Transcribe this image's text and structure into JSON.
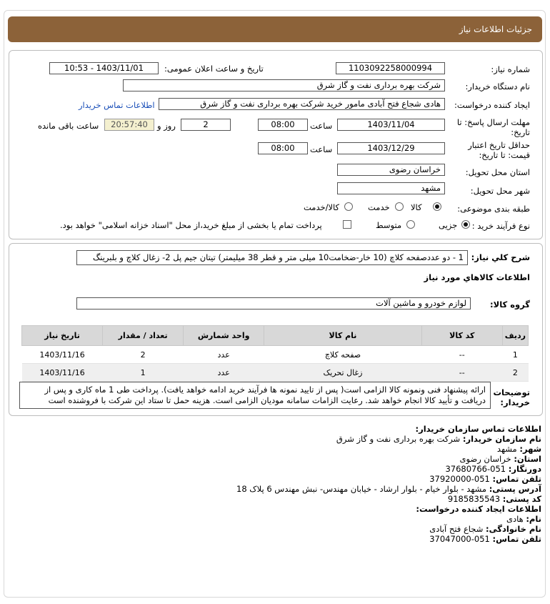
{
  "header": {
    "title": "جزئیات اطلاعات نیاز"
  },
  "form": {
    "need_number_label": "شماره نیاز:",
    "need_number": "1103092258000994",
    "announce_label": "تاریخ و ساعت اعلان عمومی:",
    "announce_value": "1403/11/01 - 10:53",
    "buyer_label": "نام دستگاه خریدار:",
    "buyer_value": "شرکت بهره برداری نفت و گاز شرق",
    "creator_label": "ایجاد کننده درخواست:",
    "creator_value": "هادی شجاع فتح آبادی مامور خرید شرکت بهره برداری نفت و گاز شرق",
    "contact_link": "اطلاعات تماس خریدار",
    "deadline_label_1": "مهلت ارسال پاسخ: تا",
    "deadline_label_2": "تاریخ:",
    "deadline_date": "1403/11/04",
    "time_label": "ساعت",
    "deadline_time": "08:00",
    "days_value": "2",
    "days_label": "روز و",
    "remaining_time": "20:57:40",
    "remaining_label": "ساعت باقی مانده",
    "validity_label_1": "حداقل تاریخ اعتبار",
    "validity_label_2": "قیمت: تا تاریخ:",
    "validity_date": "1403/12/29",
    "validity_time": "08:00",
    "province_label": "استان محل تحویل:",
    "province_value": "خراسان رضوی",
    "city_label": "شهر محل تحویل:",
    "city_value": "مشهد",
    "category_label": "طبقه بندی موضوعی:",
    "category_options": [
      "کالا",
      "خدمت",
      "کالا/خدمت"
    ],
    "category_selected": "کالا",
    "process_label": "نوع فرآیند خرید :",
    "process_options": [
      "جزیی",
      "متوسط"
    ],
    "process_selected": "جزیی",
    "treasury_text": "پرداخت تمام یا بخشی از مبلغ خرید،از محل \"اسناد خزانه اسلامی\" خواهد بود."
  },
  "description": {
    "label": "شرح کلي نياز:",
    "value": "1 - دو عددصفحه کلاچ (10 خار-ضخامت10 میلی متر و قطر 38 میلیمتر) تیتان جیم پل 2- زغال کلاچ و بلبرینگ",
    "goods_info_title": "اطلاعات کالاهاي مورد نياز",
    "group_label": "گروه کالا:",
    "group_value": "لوازم خودرو و ماشین آلات"
  },
  "table": {
    "headers": [
      "ردیف",
      "کد کالا",
      "نام کالا",
      "واحد شمارش",
      "تعداد / مقدار",
      "تاریخ نیاز"
    ],
    "rows": [
      [
        "1",
        "--",
        "صفحه کلاچ",
        "عدد",
        "2",
        "1403/11/16"
      ],
      [
        "2",
        "--",
        "زغال تحریک",
        "عدد",
        "1",
        "1403/11/16"
      ]
    ]
  },
  "notes": {
    "label_1": "توضیحات",
    "label_2": "خریدار:",
    "line_1": "ارائه پیشنهاد فنی ونمونه کالا الزامی است( پس از تایید نمونه ها فرآیند خرید ادامه خواهد یافت). پرداخت طی 1 ماه کاری و پس از",
    "line_2": "دریافت و تأیید کالا انجام خواهد شد. رعایت الزامات سامانه مودیان الزامی است. هزینه حمل تا ستاد این شرکت با فروشنده است"
  },
  "contact": {
    "org_title": "اطلاعات تماس سازمان خریدار:",
    "org_name_label": "نام سازمان خریدار:",
    "org_name": "شرکت بهره برداری نفت و گاز شرق",
    "city_label": "شهر:",
    "city": "مشهد",
    "province_label": "استان:",
    "province": "خراسان رضوی",
    "fax_label": "دورنگار:",
    "fax": "051-37680766",
    "phone_label": "تلفن تماس:",
    "phone": "051-37920000",
    "address_label": "آدرس پستی:",
    "address": "مشهد - بلوار خیام - بلوار ارشاد - خیابان مهندس- نبش مهندس 6 پلاک 18",
    "postal_label": "کد پستی:",
    "postal": "9185835543",
    "creator_title": "اطلاعات ایجاد کننده درخواست:",
    "name_label": "نام:",
    "name": "هادی",
    "family_label": "نام خانوادگی:",
    "family": "شجاع فتح آبادی",
    "creator_phone_label": "تلفن تماس:",
    "creator_phone": "051-37047000"
  }
}
